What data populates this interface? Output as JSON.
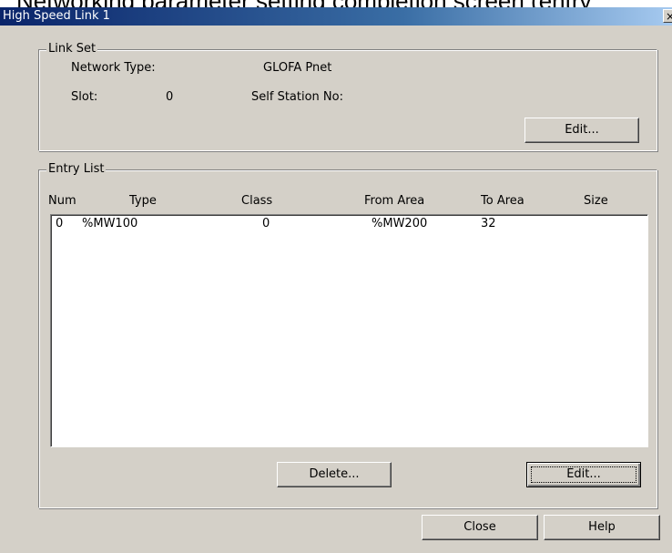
{
  "caption_fragment": "Networking parameter setting completion screen (entry",
  "window": {
    "title": "High Speed Link 1",
    "close_glyph": "×"
  },
  "link_set": {
    "legend": "Link Set",
    "network_type_label": "Network Type:",
    "network_type_value": "GLOFA Pnet",
    "slot_label": "Slot:",
    "slot_value": "0",
    "self_station_label": "Self Station No:",
    "self_station_value": "",
    "edit_button": "Edit..."
  },
  "entry_list": {
    "legend": "Entry List",
    "columns": [
      "Num",
      "Type",
      "Class",
      "From Area",
      "To Area",
      "Size"
    ],
    "rows": [
      {
        "num": "0",
        "type": "%MW100",
        "class": "0",
        "from_area": "%MW200",
        "to_area": "32",
        "size": ""
      }
    ],
    "delete_button": "Delete...",
    "edit_button": "Edit..."
  },
  "footer": {
    "close_button": "Close",
    "help_button": "Help"
  }
}
